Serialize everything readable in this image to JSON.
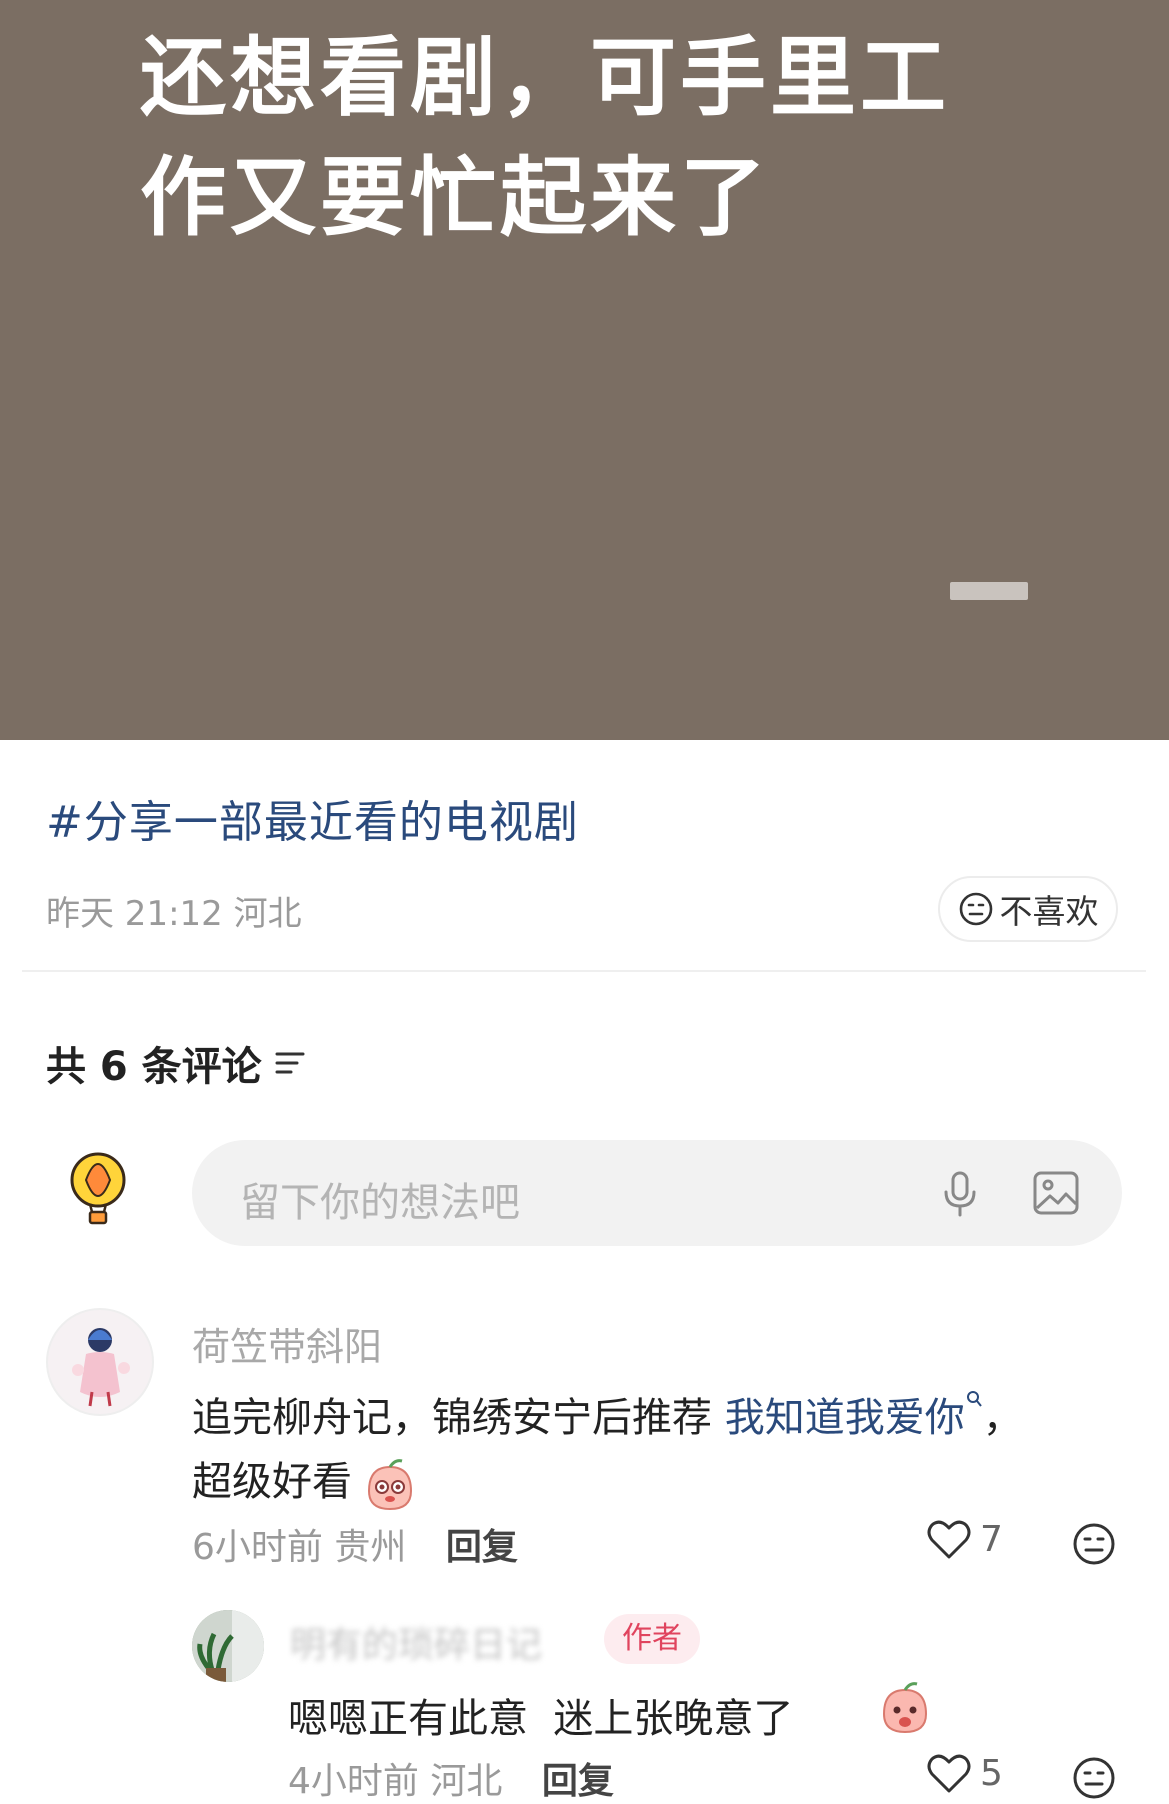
{
  "post": {
    "image_text": "还想看剧，可手里工作又要忙起来了",
    "topic": "#分享一部最近看的电视剧",
    "time": "昨天 21:12",
    "location": "河北",
    "dislike_label": "不喜欢"
  },
  "comments_section": {
    "count_label": "共 6 条评论",
    "input_placeholder": "留下你的想法吧"
  },
  "comments": [
    {
      "author": "荷笠带斜阳",
      "text_before": "追完柳舟记，锦绣安宁后推荐 ",
      "link_text": "我知道我爱你",
      "text_after": "，",
      "line2": "超级好看",
      "time": "6小时前",
      "location": "贵州",
      "reply_label": "回复",
      "likes": "7"
    },
    {
      "author": "明有的琐碎日记",
      "badge": "作者",
      "text": "嗯嗯正有此意  迷上张晚意了",
      "time": "4小时前",
      "location": "河北",
      "reply_label": "回复",
      "likes": "5"
    }
  ],
  "icons": {
    "dislike": "neutral-face-icon",
    "sort": "sort-lines-icon",
    "mascot": "hot-air-balloon-icon",
    "mic": "microphone-icon",
    "image": "image-icon",
    "like": "heart-outline-icon",
    "reaction": "neutral-face-icon"
  }
}
